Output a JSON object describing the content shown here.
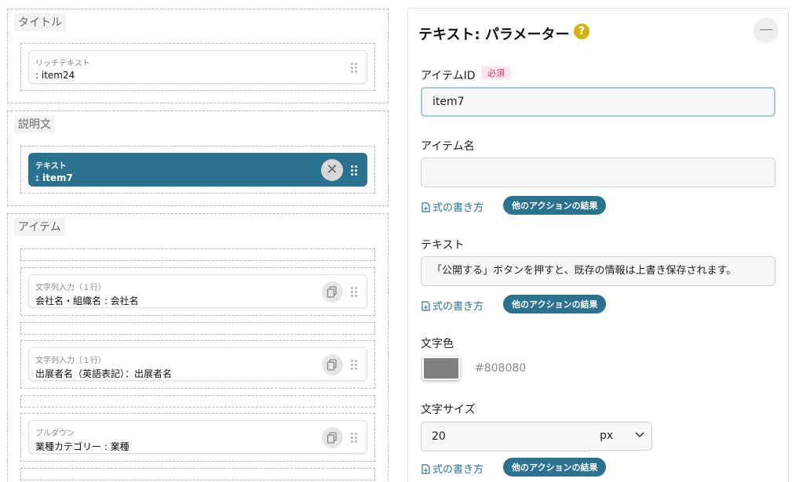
{
  "left": {
    "sections": [
      {
        "label": "タイトル",
        "cards": [
          {
            "type": "リッチテキスト",
            "name": ": item24",
            "selected": false,
            "action": "none"
          }
        ]
      },
      {
        "label": "説明文",
        "cards": [
          {
            "type": "テキスト",
            "name": ": item7",
            "selected": true,
            "action": "remove"
          }
        ]
      },
      {
        "label": "アイテム",
        "cards": [
          {
            "type": "文字列入力（１行）",
            "name": "会社名・組織名 : 会社名",
            "selected": false,
            "action": "duplicate"
          },
          {
            "type": "文字列入力（１行）",
            "name": "出展者名（英語表記）：出展者名",
            "selected": false,
            "action": "duplicate"
          },
          {
            "type": "プルダウン",
            "name": "業種カテゴリー : 業種",
            "selected": false,
            "action": "duplicate"
          }
        ]
      }
    ],
    "icons": {
      "grip": "drag-handle-icon",
      "remove": "close-icon",
      "duplicate": "copy-icon"
    }
  },
  "panel": {
    "title": "テキスト: パラメーター",
    "help": "?",
    "collapse": "—",
    "item_id": {
      "label": "アイテムID",
      "required": "必須",
      "value": "item7"
    },
    "item_name": {
      "label": "アイテム名",
      "value": ""
    },
    "text": {
      "label": "テキスト",
      "value": "「公開する」ボタンを押すと、既存の情報は上書き保存されます。"
    },
    "formula_link": "式の書き方",
    "other_results": "他のアクションの結果",
    "text_color": {
      "label": "文字色",
      "value": "#808080"
    },
    "font_size": {
      "label": "文字サイズ",
      "value": "20",
      "unit": "px"
    }
  },
  "colors": {
    "accent": "#2b7291",
    "help": "#d6b10f",
    "required_text": "#d23765",
    "swatch": "#808080"
  }
}
